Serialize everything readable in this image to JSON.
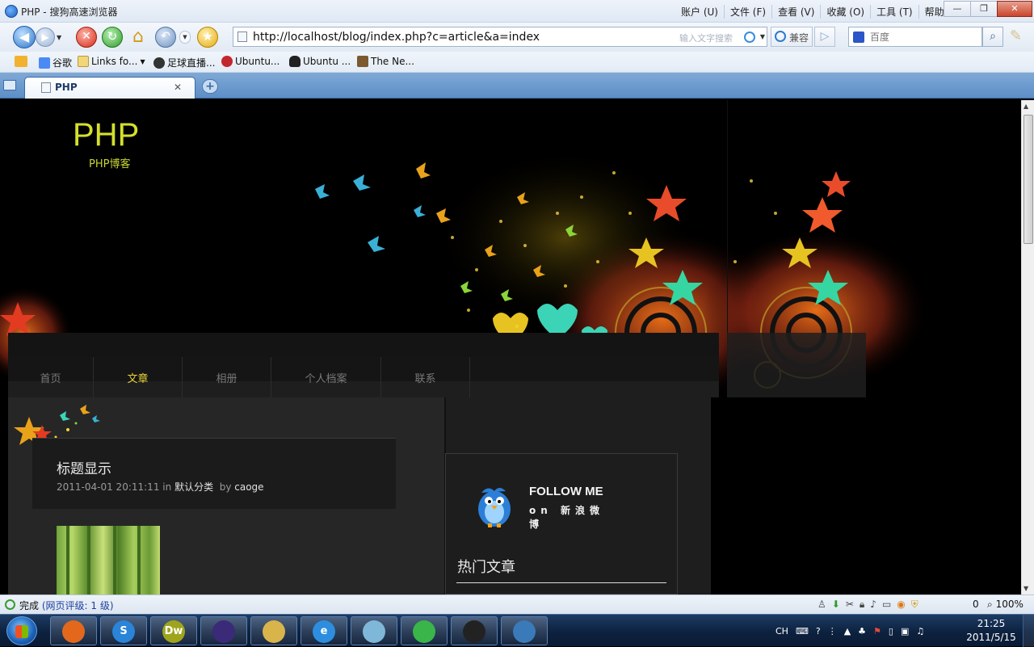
{
  "window": {
    "title": "PHP - 搜狗高速浏览器",
    "menu": [
      "账户 (U)",
      "文件 (F)",
      "查看 (V)",
      "收藏 (O)",
      "工具 (T)",
      "帮助 (H)"
    ]
  },
  "toolbar": {
    "url": "http://localhost/blog/index.php?c=article&a=index",
    "address_hint": "输入文字搜索",
    "compat_label": "兼容",
    "search_placeholder": "百度"
  },
  "bookmarks": [
    {
      "label": "谷歌",
      "icon": "google-icon",
      "color": "#4a8af4"
    },
    {
      "label": "Links fo...",
      "icon": "folder-icon",
      "color": "#f2d67a"
    },
    {
      "label": "足球直播...",
      "icon": "football-icon",
      "color": "#333333"
    },
    {
      "label": "Ubuntu...",
      "icon": "debian-swirl-icon",
      "color": "#c4262e"
    },
    {
      "label": "Ubuntu ...",
      "icon": "penguin-icon",
      "color": "#222222"
    },
    {
      "label": "The Ne...",
      "icon": "site-icon",
      "color": "#7a5a2e"
    }
  ],
  "tab": {
    "label": "PHP"
  },
  "page": {
    "site_title": "PHP",
    "site_subtitle": "PHP博客",
    "nav": [
      {
        "label": "首页",
        "active": false
      },
      {
        "label": "文章",
        "active": true
      },
      {
        "label": "相册",
        "active": false
      },
      {
        "label": "个人档案",
        "active": false
      },
      {
        "label": "联系",
        "active": false
      }
    ],
    "post": {
      "title": "标题显示",
      "date": "2011-04-01 20:11:11",
      "in_word": "in",
      "category": "默认分类",
      "by_word": "by",
      "author": "caoge"
    },
    "sidebar": {
      "follow_title": "FOLLOW ME",
      "follow_sub": "on 新浪微博",
      "hot_title": "热门文章"
    }
  },
  "status": {
    "state": "完成",
    "rating": "(网页评级: 1 级)",
    "block_count": "0",
    "zoom": "100%"
  },
  "taskbar": {
    "apps": [
      {
        "name": "firefox-icon",
        "label": "",
        "color": "#e3681c"
      },
      {
        "name": "sogou-browser-icon",
        "label": "S",
        "color": "#2a84d8"
      },
      {
        "name": "dreamweaver-icon",
        "label": "Dw",
        "color": "#9ea51c"
      },
      {
        "name": "eclipse-icon",
        "label": "",
        "color": "#3a2a78"
      },
      {
        "name": "file-explorer-icon",
        "label": "",
        "color": "#d9b44a"
      },
      {
        "name": "internet-explorer-icon",
        "label": "e",
        "color": "#2d8ee0"
      },
      {
        "name": "notepad-icon",
        "label": "",
        "color": "#7fb7d8"
      },
      {
        "name": "green-app-icon",
        "label": "",
        "color": "#39b54a"
      },
      {
        "name": "qq-icon",
        "label": "",
        "color": "#222222"
      },
      {
        "name": "image-viewer-icon",
        "label": "",
        "color": "#3a7ab8"
      }
    ],
    "lang": "CH",
    "time": "21:25",
    "date": "2011/5/15"
  }
}
